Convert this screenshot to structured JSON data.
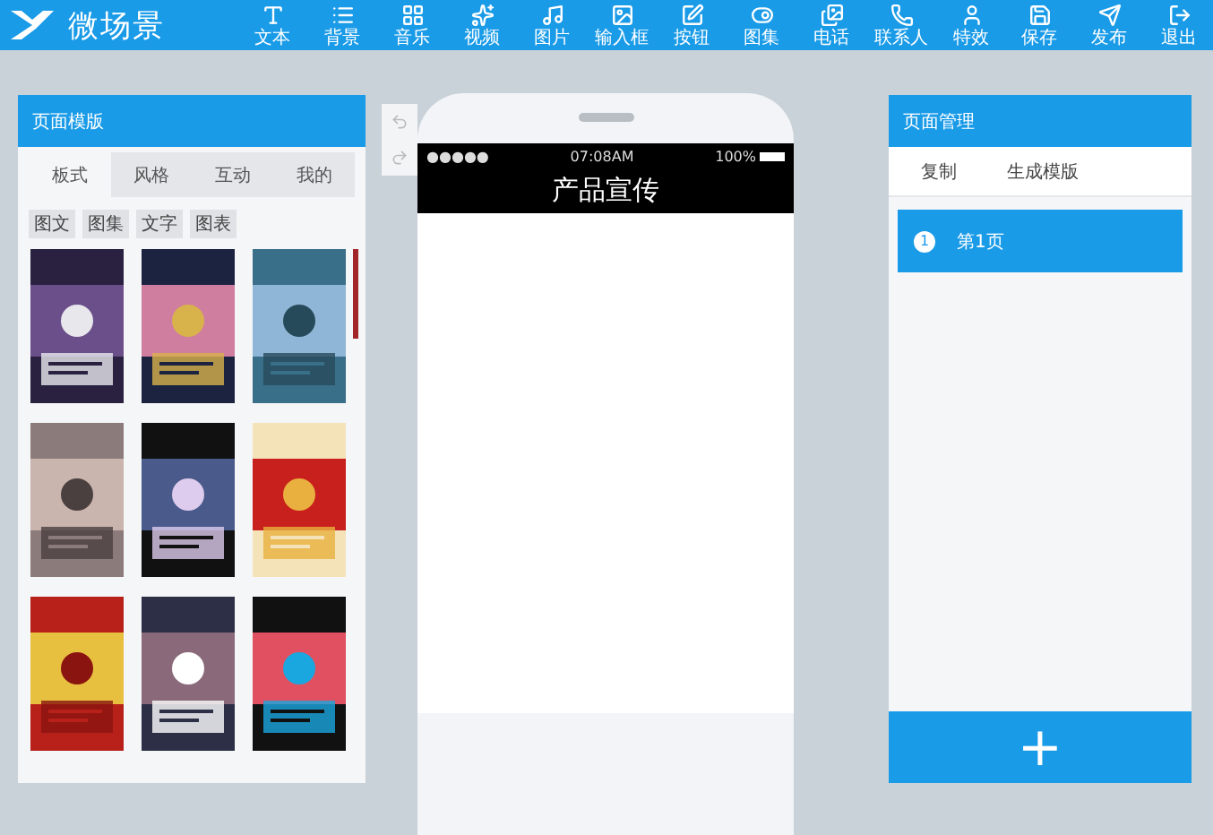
{
  "app": {
    "logo": "微场景"
  },
  "toolbar": [
    "文本",
    "背景",
    "音乐",
    "视频",
    "图片",
    "输入框",
    "按钮",
    "图集",
    "电话",
    "联系人",
    "特效"
  ],
  "actions": [
    "保存",
    "发布",
    "退出"
  ],
  "template_panel": {
    "title": "页面模版",
    "tabs": [
      {
        "label": "板式",
        "selected": true
      },
      {
        "label": "风格",
        "selected": false
      },
      {
        "label": "互动",
        "selected": false
      },
      {
        "label": "我的",
        "selected": false
      }
    ],
    "filters": [
      "图文",
      "图集",
      "文字",
      "图表"
    ]
  },
  "phone": {
    "signal": "●●●●●",
    "time": "07:08AM",
    "battery": "100%",
    "title": "产品宣传"
  },
  "page_panel": {
    "title": "页面管理",
    "actions": [
      "复制",
      "生成模版"
    ],
    "pages": [
      {
        "number": "1",
        "label": "第1页",
        "selected": true
      }
    ],
    "add_button": "+"
  }
}
